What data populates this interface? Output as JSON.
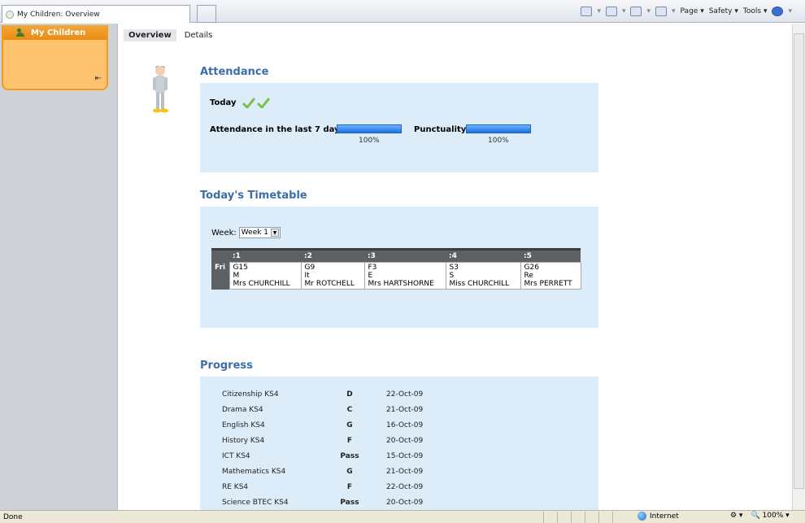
{
  "browser": {
    "tab_title": "My Children: Overview",
    "commands": [
      "Page",
      "Safety",
      "Tools"
    ]
  },
  "sidebar": {
    "title": "My Children"
  },
  "tabs": [
    {
      "label": "Overview",
      "active": true
    },
    {
      "label": "Details",
      "active": false
    }
  ],
  "attendance": {
    "title": "Attendance",
    "today_label": "Today",
    "last7_label": "Attendance in the last 7 days",
    "last7_value": "100%",
    "punctuality_label": "Punctuality",
    "punctuality_value": "100%"
  },
  "timetable": {
    "title": "Today's Timetable",
    "week_label": "Week:",
    "week_value": "Week 1",
    "columns": [
      ":1",
      ":2",
      ":3",
      ":4",
      ":5"
    ],
    "day": "Fri",
    "lessons": [
      {
        "room": "G15",
        "subject": "M",
        "teacher": "Mrs CHURCHILL"
      },
      {
        "room": "G9",
        "subject": "It",
        "teacher": "Mr ROTCHELL"
      },
      {
        "room": "F3",
        "subject": "E",
        "teacher": "Mrs HARTSHORNE"
      },
      {
        "room": "S3",
        "subject": "S",
        "teacher": "Miss CHURCHILL"
      },
      {
        "room": "G26",
        "subject": "Re",
        "teacher": "Mrs PERRETT"
      }
    ]
  },
  "progress": {
    "title": "Progress",
    "rows": [
      {
        "subject": "Citizenship KS4",
        "grade": "D",
        "date": "22-Oct-09"
      },
      {
        "subject": "Drama KS4",
        "grade": "C",
        "date": "21-Oct-09"
      },
      {
        "subject": "English KS4",
        "grade": "G",
        "date": "16-Oct-09"
      },
      {
        "subject": "History KS4",
        "grade": "F",
        "date": "20-Oct-09"
      },
      {
        "subject": "ICT KS4",
        "grade": "Pass",
        "date": "15-Oct-09"
      },
      {
        "subject": "Mathematics KS4",
        "grade": "G",
        "date": "21-Oct-09"
      },
      {
        "subject": "RE KS4",
        "grade": "F",
        "date": "22-Oct-09"
      },
      {
        "subject": "Science BTEC KS4",
        "grade": "Pass",
        "date": "20-Oct-09"
      }
    ]
  },
  "status": {
    "left": "Done",
    "zone": "Internet",
    "zoom": "100%"
  }
}
